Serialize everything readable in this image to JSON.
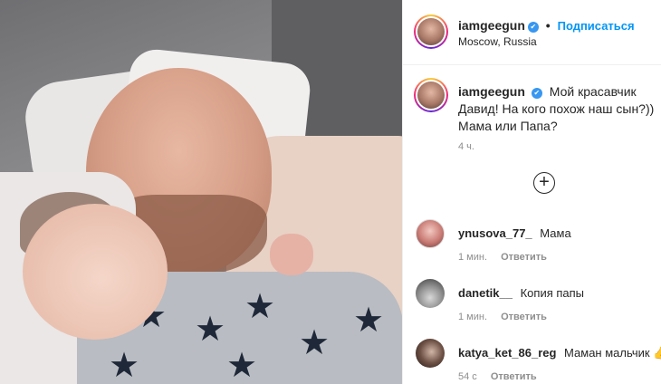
{
  "header": {
    "username": "iamgeegun",
    "separator": "•",
    "follow_label": "Подписаться",
    "location": "Moscow, Russia"
  },
  "caption": {
    "username": "iamgeegun",
    "text": "Мой красавчик Давид! На кого похож наш сын?)) Мама или Папа?",
    "time": "4 ч."
  },
  "load_more_icon": "plus-circle-icon",
  "comments": [
    {
      "username": "ynusova_77_",
      "text": "Мама",
      "time": "1 мин.",
      "reply_label": "Ответить"
    },
    {
      "username": "danetik__",
      "text": "Копия папы",
      "time": "1 мин.",
      "reply_label": "Ответить"
    },
    {
      "username": "katya_ket_86_reg",
      "text": "Маман мальчик 👍",
      "time": "54 с",
      "reply_label": "Ответить"
    }
  ],
  "colors": {
    "link_blue": "#0095f6",
    "verified_blue": "#3897f0",
    "meta_gray": "#8e8e8e"
  }
}
